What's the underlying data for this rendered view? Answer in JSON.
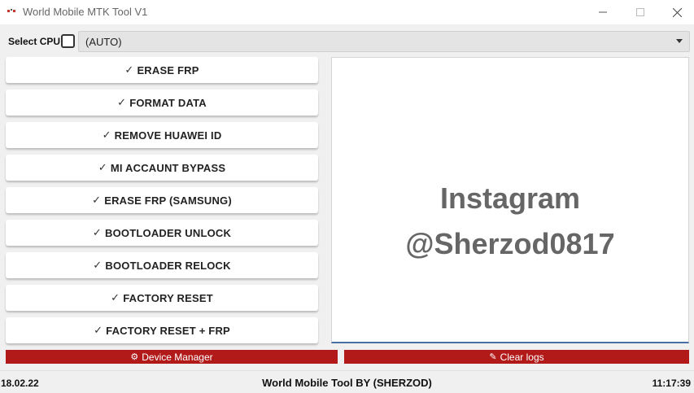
{
  "window": {
    "title": "World Mobile MTK Tool V1",
    "icon": "app-logo-icon"
  },
  "cpu": {
    "label": "Select CPU:",
    "checked": false,
    "selected": "(AUTO)"
  },
  "actions": [
    {
      "label": "ERASE FRP"
    },
    {
      "label": "FORMAT DATA"
    },
    {
      "label": "REMOVE HUAWEI ID"
    },
    {
      "label": "MI ACCAUNT BYPASS"
    },
    {
      "label": "ERASE FRP (SAMSUNG)"
    },
    {
      "label": "BOOTLOADER UNLOCK"
    },
    {
      "label": "BOOTLOADER RELOCK"
    },
    {
      "label": "FACTORY RESET"
    },
    {
      "label": "FACTORY RESET + FRP"
    }
  ],
  "check_glyph": "✓",
  "log_panel": {
    "line1": "Instagram",
    "line2": "@Sherzod0817"
  },
  "buttons": {
    "device_manager": "Device Manager",
    "device_manager_icon": "gear-icon",
    "clear_logs": "Clear logs",
    "clear_logs_icon": "pencil-icon"
  },
  "status": {
    "date": "18.02.22",
    "center": "World Mobile Tool BY (SHERZOD)",
    "time": "11:17:39"
  },
  "colors": {
    "accent_red": "#b21a1a",
    "promo_text": "#666666"
  }
}
